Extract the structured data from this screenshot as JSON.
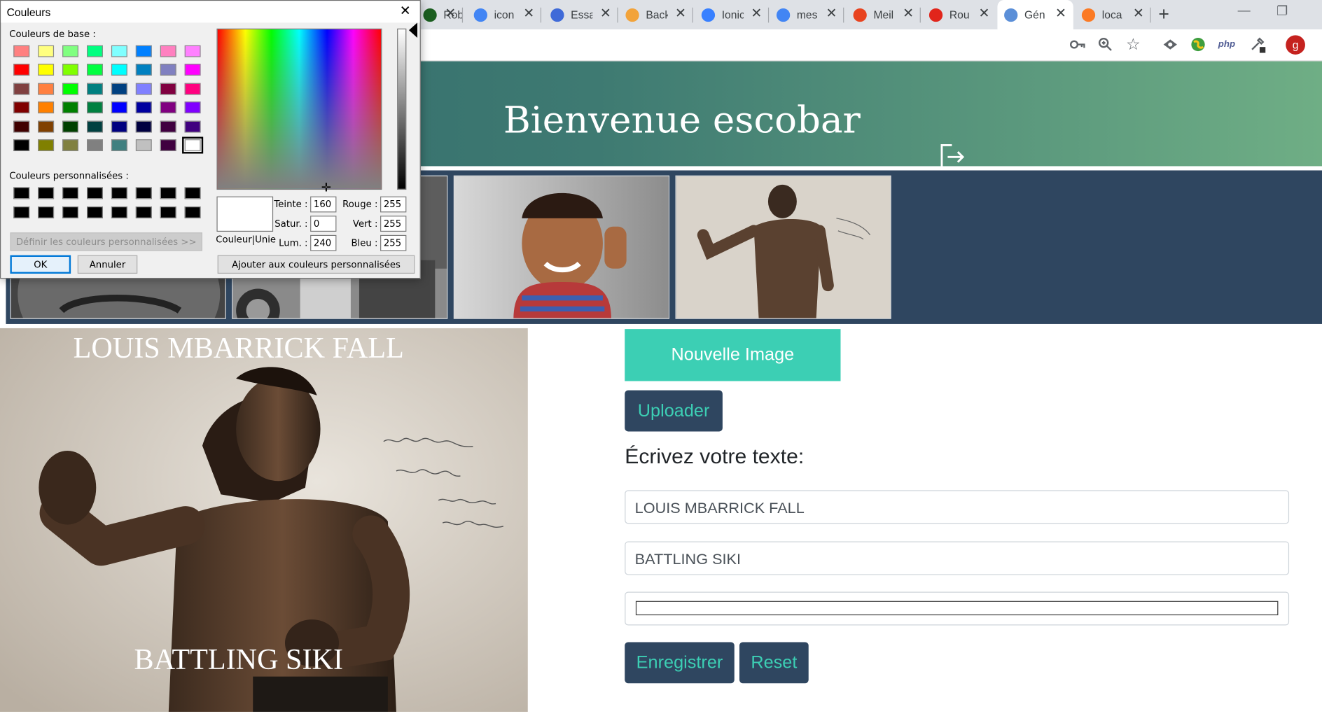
{
  "browser": {
    "tabs": [
      {
        "title": "Robi",
        "favicon": "robi-tab-icon",
        "color": "#1b5e20"
      },
      {
        "title": "icon",
        "favicon": "google-icon",
        "color": "#4285f4"
      },
      {
        "title": "Essa",
        "favicon": "c-icon",
        "color": "#3f6ad8"
      },
      {
        "title": "Back",
        "favicon": "folder-icon",
        "color": "#f2a33a"
      },
      {
        "title": "Ionic",
        "favicon": "ionic-icon",
        "color": "#3880ff"
      },
      {
        "title": "mes",
        "favicon": "google-icon",
        "color": "#4285f4"
      },
      {
        "title": "Meil",
        "favicon": "brave-icon",
        "color": "#e8431f"
      },
      {
        "title": "Rou",
        "favicon": "adobe-icon",
        "color": "#e1251b"
      },
      {
        "title": "Gén",
        "favicon": "bootstrap-icon",
        "color": "#5b8fd8"
      },
      {
        "title": "loca",
        "favicon": "xampp-icon",
        "color": "#fb7a24"
      }
    ],
    "toolbar_icons": [
      "key-icon",
      "zoom-icon",
      "star-icon",
      "eye-extension-icon",
      "globe-extension-icon",
      "php-extension-icon",
      "eyedropper-extension-icon"
    ],
    "php_label": "php",
    "profile_initial": "g",
    "profile_color": "#c5221f"
  },
  "page": {
    "welcome": "Bienvenue escobar",
    "gallery_bg": "#2f4660",
    "gallery": [
      {
        "name": "thumb-portrait-old-man"
      },
      {
        "name": "thumb-street-wheels"
      },
      {
        "name": "thumb-smiling-boy"
      },
      {
        "name": "thumb-boxer"
      }
    ],
    "meme": {
      "top_text": "LOUIS MBARRICK FALL",
      "bottom_text": "BATTLING SIKI",
      "handwriting": "Faites vos Photographies chez Merlig en face la Mairie Rue Alsace 13"
    },
    "controls": {
      "new_image": "Nouvelle Image",
      "upload": "Uploader",
      "prompt": "Écrivez votre texte:",
      "field1": "LOUIS MBARRICK FALL",
      "field2": "BATTLING SIKI",
      "save": "Enregistrer",
      "reset": "Reset",
      "accent": "#3ccfb4",
      "dark": "#2f4660"
    }
  },
  "dialog": {
    "title": "Couleurs",
    "base_label": "Couleurs de base :",
    "custom_label": "Couleurs personnalisées :",
    "define_custom": "Définir les couleurs personnalisées >>",
    "ok": "OK",
    "cancel": "Annuler",
    "add_custom": "Ajouter aux couleurs personnalisées",
    "solid_label": "Couleur|Unie",
    "hue_label": "Teinte :",
    "sat_label": "Satur. :",
    "lum_label": "Lum. :",
    "red_label": "Rouge :",
    "green_label": "Vert :",
    "blue_label": "Bleu :",
    "hue": "160",
    "sat": "0",
    "lum": "240",
    "red": "255",
    "green": "255",
    "blue": "255",
    "base_colors": [
      "#ff8080",
      "#ffff80",
      "#80ff80",
      "#00ff80",
      "#80ffff",
      "#0080ff",
      "#ff80c0",
      "#ff80ff",
      "#ff0000",
      "#ffff00",
      "#80ff00",
      "#00ff40",
      "#00ffff",
      "#0080c0",
      "#8080c0",
      "#ff00ff",
      "#804040",
      "#ff8040",
      "#00ff00",
      "#008080",
      "#004080",
      "#8080ff",
      "#800040",
      "#ff0080",
      "#800000",
      "#ff8000",
      "#008000",
      "#008040",
      "#0000ff",
      "#0000a0",
      "#800080",
      "#8000ff",
      "#400000",
      "#804000",
      "#004000",
      "#004040",
      "#000080",
      "#000040",
      "#400040",
      "#400080",
      "#000000",
      "#808000",
      "#808040",
      "#808080",
      "#408080",
      "#c0c0c0",
      "#400040",
      "#ffffff"
    ],
    "custom_colors": [
      "#000000",
      "#000000",
      "#000000",
      "#000000",
      "#000000",
      "#000000",
      "#000000",
      "#000000",
      "#000000",
      "#000000",
      "#000000",
      "#000000",
      "#000000",
      "#000000",
      "#000000",
      "#000000"
    ]
  }
}
